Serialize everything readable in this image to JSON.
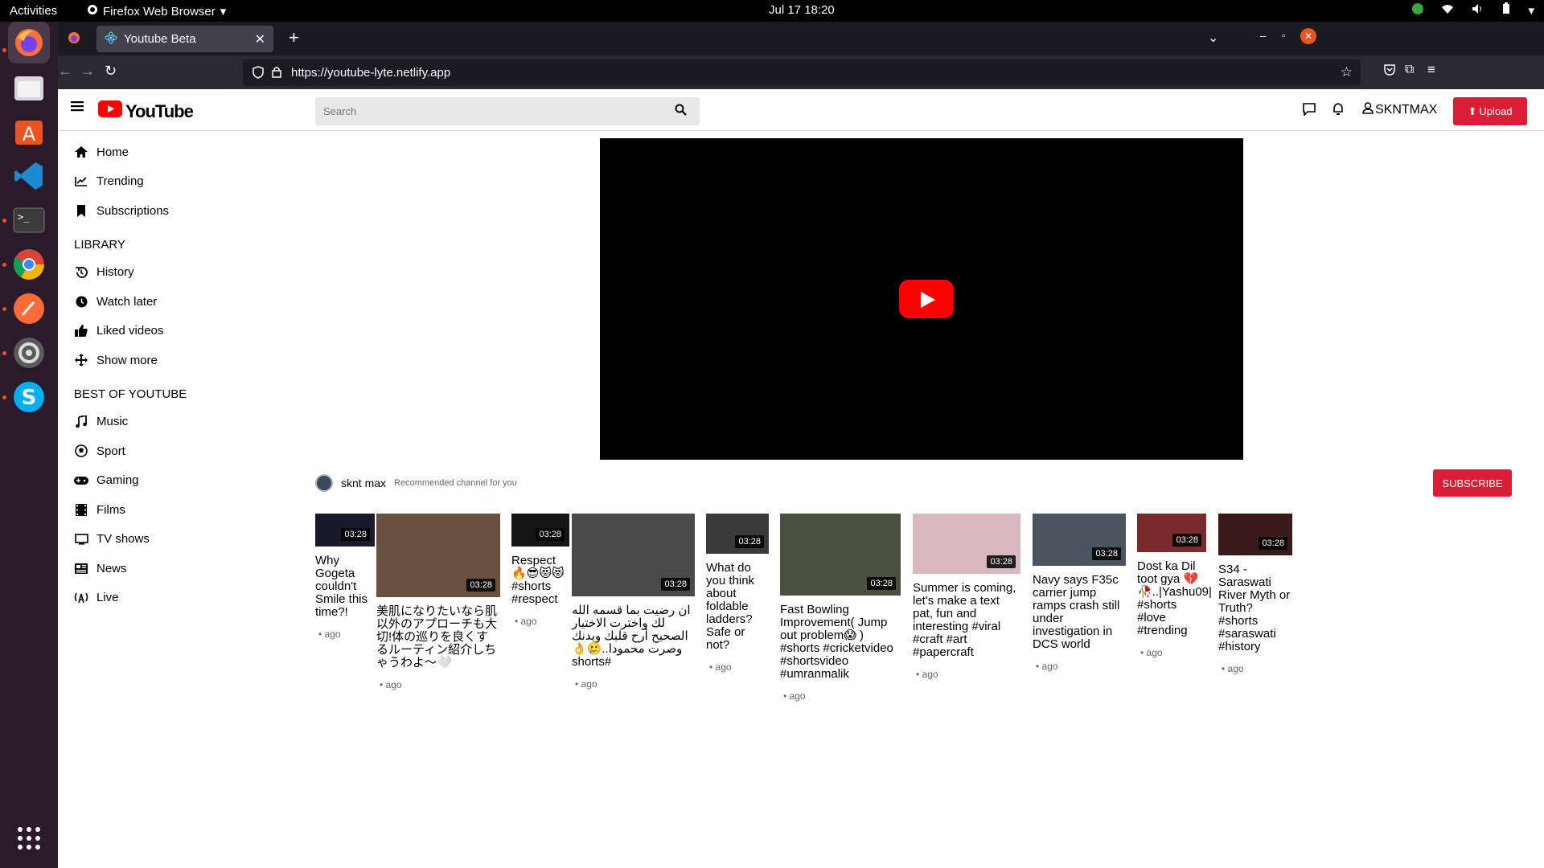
{
  "os": {
    "activities": "Activities",
    "app_name": "Firefox Web Browser",
    "clock": "Jul 17  18:20"
  },
  "browser": {
    "tab_title": "Youtube Beta",
    "url": "https://youtube-lyte.netlify.app"
  },
  "header": {
    "logo_text": "YouTube",
    "search_placeholder": "Search",
    "user_name": "SKNTMAX",
    "upload_label": "Upload"
  },
  "sidebar": {
    "main": [
      {
        "label": "Home",
        "icon": "home-icon"
      },
      {
        "label": "Trending",
        "icon": "trending-icon"
      },
      {
        "label": "Subscriptions",
        "icon": "subscriptions-icon"
      }
    ],
    "library_heading": "LIBRARY",
    "library": [
      {
        "label": "History",
        "icon": "history-icon"
      },
      {
        "label": "Watch later",
        "icon": "clock-icon"
      },
      {
        "label": "Liked videos",
        "icon": "thumbs-up-icon"
      },
      {
        "label": "Show more",
        "icon": "move-icon"
      }
    ],
    "best_heading": "BEST OF YOUTUBE",
    "best": [
      {
        "label": "Music",
        "icon": "music-icon"
      },
      {
        "label": "Sport",
        "icon": "sport-icon"
      },
      {
        "label": "Gaming",
        "icon": "gamepad-icon"
      },
      {
        "label": "Films",
        "icon": "film-icon"
      },
      {
        "label": "TV shows",
        "icon": "tv-icon"
      },
      {
        "label": "News",
        "icon": "news-icon"
      },
      {
        "label": "Live",
        "icon": "live-icon"
      }
    ]
  },
  "channel": {
    "name": "sknt max",
    "recommendation": "Recommended channel for you",
    "subscribe_label": "SUBSCRIBE"
  },
  "videos": [
    {
      "title": "Why Gogeta couldn't Smile this time?!",
      "duration": "03:28",
      "meta": "• ago",
      "color": "#1a1a2a"
    },
    {
      "title": "美肌になりたいなら肌以外のアプローチも大切!体の巡りを良くするルーティン紹介しちゃうわよ〜🤍",
      "duration": "03:28",
      "meta": "• ago",
      "color": "#6a5040"
    },
    {
      "title": "Respect 🔥😎😻😻 #shorts #respect",
      "duration": "03:28",
      "meta": "• ago",
      "color": "#151515"
    },
    {
      "title": "ان رضيت بما قسمه الله لك واخترت الاختيار الصحيح أرح قلبك وبدنك وصرت محمودا..🥲👌 #shorts",
      "duration": "03:28",
      "meta": "• ago",
      "color": "#4a4a4a"
    },
    {
      "title": "What do you think about foldable ladders? Safe or not?",
      "duration": "03:28",
      "meta": "• ago",
      "color": "#3a3a3a"
    },
    {
      "title": "Fast Bowling Improvement( Jump out problem😱 ) #shorts #cricketvideo #shortsvideo #umranmalik",
      "duration": "03:28",
      "meta": "• ago",
      "color": "#4a5040"
    },
    {
      "title": "Summer is coming, let's make a text pat, fun and interesting #viral #craft #art #papercraft",
      "duration": "03:28",
      "meta": "• ago",
      "color": "#d8b8c0"
    },
    {
      "title": "Navy says F35c carrier jump ramps crash still under investigation in DCS world",
      "duration": "03:28",
      "meta": "• ago",
      "color": "#4a5560"
    },
    {
      "title": "Dost ka Dil toot gya 💔🥀..|Yashu09| #shorts #love #trending",
      "duration": "03:28",
      "meta": "• ago",
      "color": "#7a2a2a"
    },
    {
      "title": "S34 - Saraswati River Myth or Truth? #shorts #saraswati #history",
      "duration": "03:28",
      "meta": "• ago",
      "color": "#3a1a18"
    }
  ]
}
